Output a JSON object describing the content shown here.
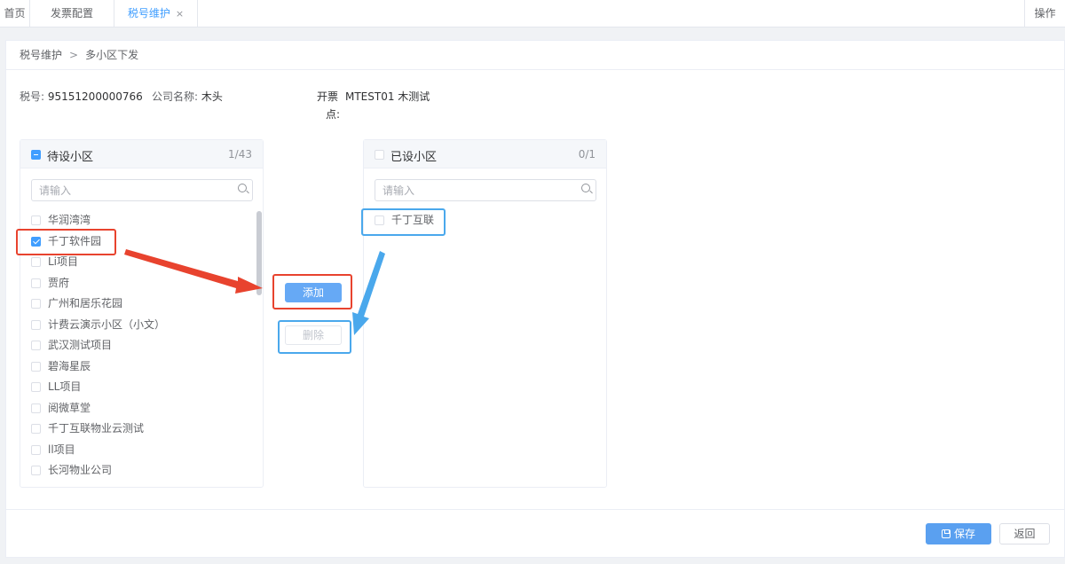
{
  "tabs": [
    {
      "label": "首页"
    },
    {
      "label": "发票配置"
    },
    {
      "label": "税号维护",
      "close": "×"
    }
  ],
  "tabbar_ops": "操作",
  "breadcrumb": {
    "parent": "税号维护",
    "separator": ">",
    "current": "多小区下发"
  },
  "info": {
    "tax_label": "税号:",
    "tax_value": "95151200000766",
    "company_label": "公司名称:",
    "company_value": "木头",
    "invoice_label_1": "开票",
    "invoice_label_2": "点:",
    "invoice_value": "MTEST01 木测试"
  },
  "left_panel": {
    "title": "待设小区",
    "count": "1/43",
    "search_placeholder": "请输入",
    "items": [
      {
        "label": "华润湾湾",
        "checked": false
      },
      {
        "label": "千丁软件园",
        "checked": true
      },
      {
        "label": "Li项目",
        "checked": false
      },
      {
        "label": "贾府",
        "checked": false
      },
      {
        "label": "广州和居乐花园",
        "checked": false
      },
      {
        "label": "计费云演示小区（小文）",
        "checked": false
      },
      {
        "label": "武汉测试项目",
        "checked": false
      },
      {
        "label": "碧海星辰",
        "checked": false
      },
      {
        "label": "LL项目",
        "checked": false
      },
      {
        "label": "阅微草堂",
        "checked": false
      },
      {
        "label": "千丁互联物业云测试",
        "checked": false
      },
      {
        "label": "ll项目",
        "checked": false
      },
      {
        "label": "长河物业公司",
        "checked": false
      }
    ]
  },
  "right_panel": {
    "title": "已设小区",
    "count": "0/1",
    "search_placeholder": "请输入",
    "items": [
      {
        "label": "千丁互联",
        "checked": false
      }
    ]
  },
  "buttons": {
    "add": "添加",
    "delete": "删除",
    "save": "保存",
    "back": "返回"
  },
  "colors": {
    "primary": "#409eff",
    "annotation_red": "#e8432e",
    "annotation_blue": "#4aa8ec"
  }
}
